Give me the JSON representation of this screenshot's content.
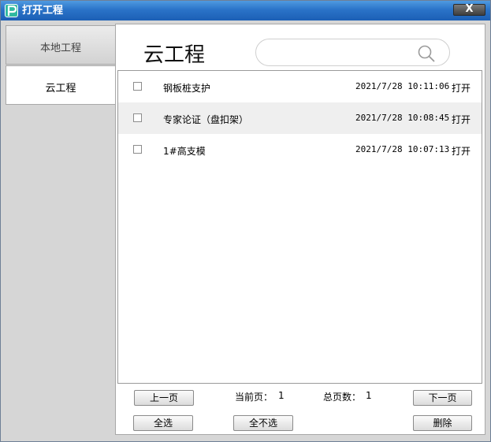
{
  "window": {
    "title": "打开工程",
    "close_label": "X"
  },
  "sidebar": {
    "tabs": [
      {
        "label": "本地工程",
        "active": false
      },
      {
        "label": "云工程",
        "active": true
      }
    ]
  },
  "main": {
    "title": "云工程",
    "search": {
      "value": "",
      "placeholder": ""
    }
  },
  "projects": [
    {
      "name": "钢板桩支护",
      "date": "2021/7/28 10:11:06",
      "action": "打开",
      "checked": false
    },
    {
      "name": "专家论证（盘扣架）",
      "date": "2021/7/28 10:08:45",
      "action": "打开",
      "checked": false
    },
    {
      "name": "1#高支模",
      "date": "2021/7/28 10:07:13",
      "action": "打开",
      "checked": false
    }
  ],
  "pagination": {
    "prev_label": "上一页",
    "next_label": "下一页",
    "current_label": "当前页：",
    "current_value": "1",
    "total_label": "总页数：",
    "total_value": "1"
  },
  "actions": {
    "select_all": "全选",
    "select_none": "全不选",
    "delete": "删除"
  },
  "colors": {
    "titlebar": "#2a73c8",
    "logo": "#2fb9a0",
    "row_alt": "#efefef"
  }
}
